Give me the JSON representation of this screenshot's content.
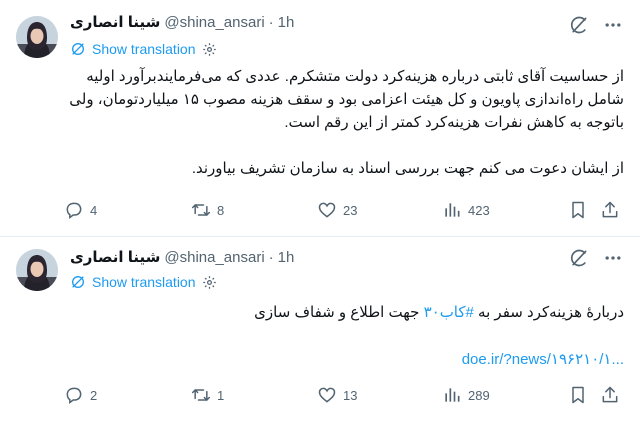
{
  "tweets": [
    {
      "author_name": "شینا انصاری",
      "handle": "@shina_ansari",
      "separator": "·",
      "time": "1h",
      "show_translation": "Show translation",
      "lines": [
        "از حساسیت آقای ثابتی درباره هزینه‌کرد دولت متشکرم. عددی که می‌فرمایندبرآورد اولیه",
        "شامل راه‌اندازی پاویون و کل هیئت اعزامی بود و سقف هزینه مصوب ۱۵ میلیاردتومان، ولی",
        "باتوجه به کاهش نفرات هزینه‌کرد کمتر از این رقم است.",
        "",
        "از ایشان دعوت می کنم جهت بررسی اسناد به سازمان تشریف بیاورند."
      ],
      "replies": "4",
      "reposts": "8",
      "likes": "23",
      "views": "423"
    },
    {
      "author_name": "شینا انصاری",
      "handle": "@shina_ansari",
      "separator": "·",
      "time": "1h",
      "show_translation": "Show translation",
      "text_before": "دربارهٔ هزینه‌کرد سفر به ",
      "hashtag": "#کاب۳۰",
      "text_after": " جهت اطلاع و شفاف سازی",
      "link": "doe.ir/?news/۱۹۶۲۱۰/۱...",
      "replies": "2",
      "reposts": "1",
      "likes": "13",
      "views": "289"
    }
  ],
  "icons": {
    "grok": "grok-icon",
    "more": "more-icon",
    "translate_settings": "gear-icon",
    "reply": "reply-icon",
    "repost": "repost-icon",
    "like": "heart-icon",
    "views": "views-icon",
    "bookmark": "bookmark-icon",
    "share": "share-icon"
  },
  "colors": {
    "accent": "#1d9bf0",
    "text": "#0f1419",
    "muted": "#536471",
    "divider": "#e6ecf0"
  }
}
